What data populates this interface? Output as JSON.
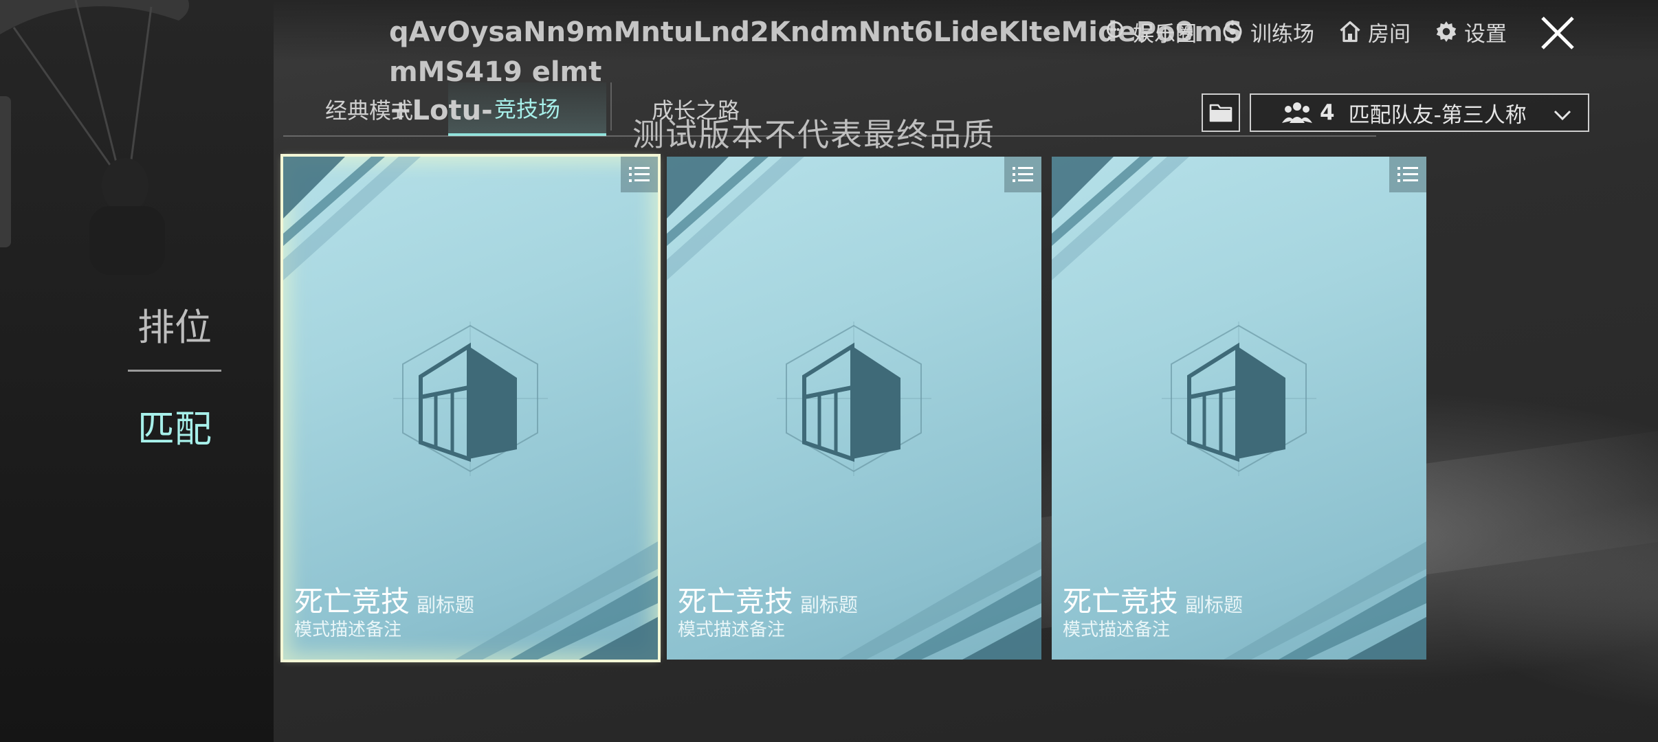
{
  "debug": {
    "session_id": "qAvOysaNn9mMntuLnd2KndmNnt6LideKlteMidePo9mSmMS419 elmt",
    "session_tail": "+Lotu-",
    "watermark": "测试版本不代表最终品质"
  },
  "header": {
    "menu": [
      {
        "icon": "entertainment-icon",
        "label": "娱乐圈"
      },
      {
        "icon": "training-icon",
        "label": "训练场"
      },
      {
        "icon": "home-icon",
        "label": "房间"
      },
      {
        "icon": "gear-icon",
        "label": "设置"
      }
    ],
    "close_icon": "close-icon"
  },
  "tabs": [
    {
      "label": "经典模式",
      "active": false
    },
    {
      "label": "竞技场",
      "active": true
    },
    {
      "label": "成长之路",
      "active": false
    }
  ],
  "side_nav": [
    {
      "label": "排位",
      "active": false
    },
    {
      "label": "匹配",
      "active": true
    }
  ],
  "team_select": {
    "count": "4",
    "label": "匹配队友-第三人称"
  },
  "cards": [
    {
      "title": "死亡竞技",
      "subtitle": "副标题",
      "description": "模式描述备注",
      "selected": true
    },
    {
      "title": "死亡竞技",
      "subtitle": "副标题",
      "description": "模式描述备注",
      "selected": false
    },
    {
      "title": "死亡竞技",
      "subtitle": "副标题",
      "description": "模式描述备注",
      "selected": false
    }
  ],
  "colors": {
    "accent": "#a7f0ea",
    "card_bg": "#a6d5df",
    "selected_glow": "#f3f7d6"
  }
}
